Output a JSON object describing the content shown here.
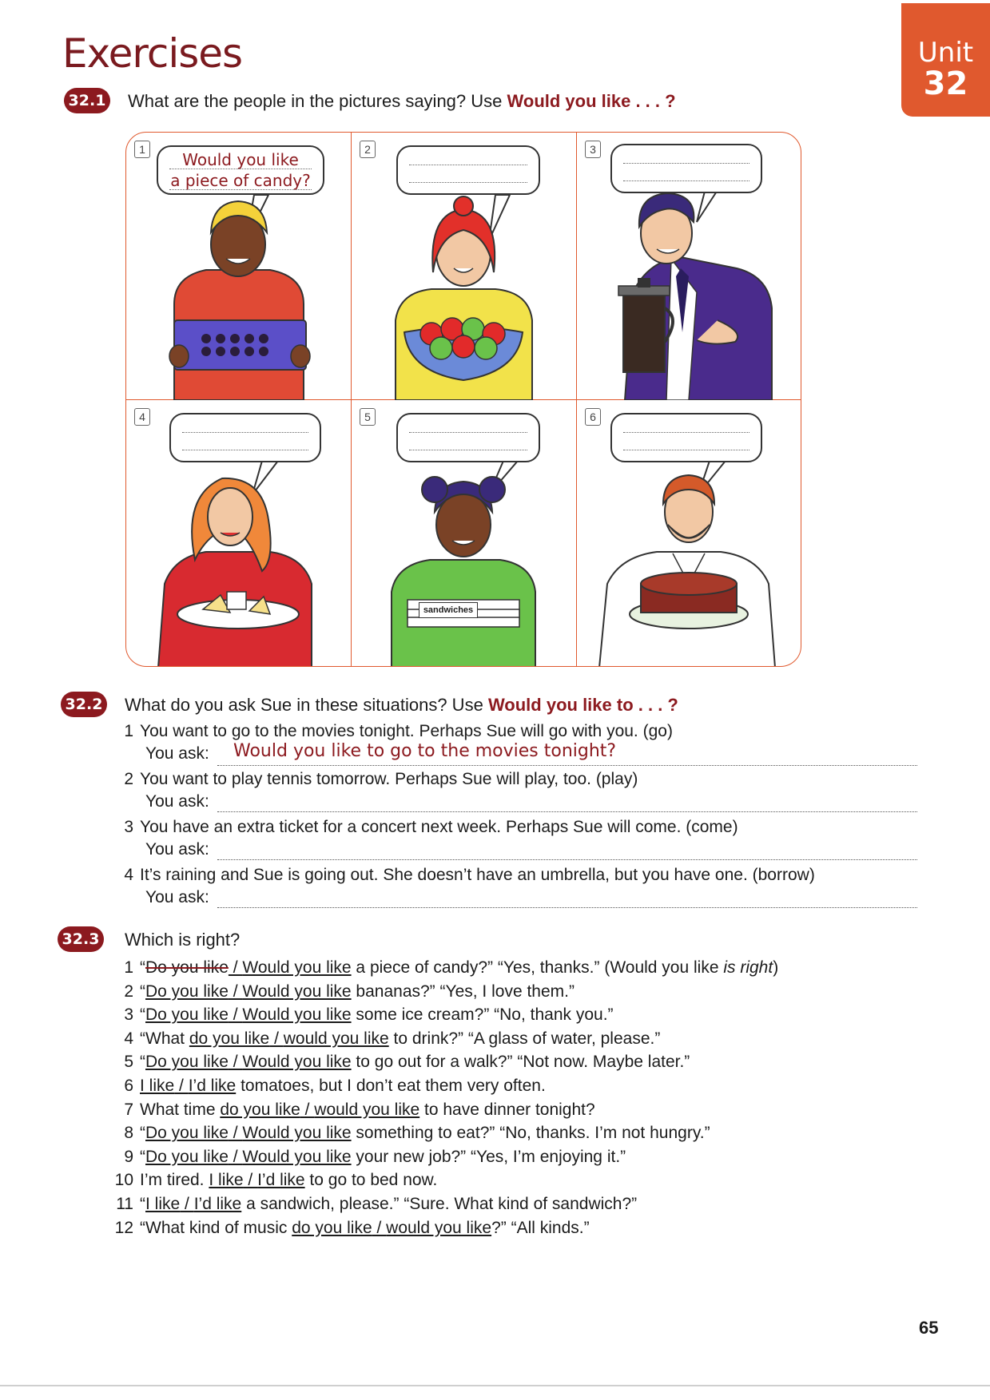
{
  "header": {
    "title": "Exercises",
    "unit_label": "Unit",
    "unit_number": "32"
  },
  "ex1": {
    "badge": "32.1",
    "prompt": "What are the people in the pictures saying? Use",
    "prompt_bold": "Would you like . . . ?",
    "cells": [
      {
        "num": "1",
        "answer_line1": "Would you like",
        "answer_line2": "a piece of candy?"
      },
      {
        "num": "2"
      },
      {
        "num": "3"
      },
      {
        "num": "4"
      },
      {
        "num": "5",
        "sign": "sandwiches"
      },
      {
        "num": "6"
      }
    ]
  },
  "ex2": {
    "badge": "32.2",
    "prompt": "What do you ask Sue in these situations? Use",
    "prompt_bold": "Would you like to . . . ?",
    "ask_label": "You ask:",
    "items": [
      {
        "n": "1",
        "text": "You want to go to the movies tonight.  Perhaps Sue will go with you.  (go)",
        "answer": "Would you like to go to the movies tonight?"
      },
      {
        "n": "2",
        "text": "You want to play tennis tomorrow.  Perhaps Sue will play, too.  (play)",
        "answer": ""
      },
      {
        "n": "3",
        "text": "You have an extra ticket for a concert next week.  Perhaps Sue will come.  (come)",
        "answer": ""
      },
      {
        "n": "4",
        "text": "It’s raining and Sue is going out.  She doesn’t have an umbrella, but you have one.  (borrow)",
        "answer": ""
      }
    ]
  },
  "ex3": {
    "badge": "32.3",
    "prompt": "Which is right?",
    "items": [
      {
        "n": "1",
        "pre": "“",
        "s1": "Do you like",
        "sep": " / ",
        "s2": "Would you like",
        "post": " a piece of candy?”   “Yes, thanks.”  (Would you like ",
        "note": "is right",
        "close": ")"
      },
      {
        "n": "2",
        "pre": "“",
        "s1": "Do you like",
        "sep": " / ",
        "s2": "Would you like",
        "post": " bananas?”   “Yes, I love them.”"
      },
      {
        "n": "3",
        "pre": "“",
        "s1": "Do you like",
        "sep": " / ",
        "s2": "Would you like",
        "post": " some ice cream?”   “No, thank you.”"
      },
      {
        "n": "4",
        "pre": "“What ",
        "s1": "do you like",
        "sep": " / ",
        "s2": "would you like",
        "post": " to drink?”   “A glass of water, please.”"
      },
      {
        "n": "5",
        "pre": "“",
        "s1": "Do you like",
        "sep": " / ",
        "s2": "Would you like",
        "post": " to go out for a walk?”   “Not now.  Maybe later.”"
      },
      {
        "n": "6",
        "pre": "",
        "s1": "I like",
        "sep": " / ",
        "s2": "I’d like",
        "post": " tomatoes, but I don’t eat them very often."
      },
      {
        "n": "7",
        "pre": "What time ",
        "s1": "do you like",
        "sep": " / ",
        "s2": "would you like",
        "post": " to have dinner tonight?"
      },
      {
        "n": "8",
        "pre": "“",
        "s1": "Do you like",
        "sep": " / ",
        "s2": "Would you like",
        "post": " something to eat?”   “No, thanks.  I’m not hungry.”"
      },
      {
        "n": "9",
        "pre": "“",
        "s1": "Do you like",
        "sep": " / ",
        "s2": "Would you like",
        "post": " your new job?”   “Yes, I’m enjoying it.”"
      },
      {
        "n": "10",
        "pre": "I’m tired. ",
        "s1": "I like",
        "sep": " / ",
        "s2": "I’d like",
        "post": " to go to bed now."
      },
      {
        "n": "11",
        "pre": "“",
        "s1": "I like",
        "sep": " / ",
        "s2": "I’d like",
        "post": " a sandwich, please.”   “Sure.  What kind of sandwich?”"
      },
      {
        "n": "12",
        "pre": "“What kind of music ",
        "s1": "do you like",
        "sep": " / ",
        "s2": "would you like",
        "post": "?”   “All kinds.”"
      }
    ]
  },
  "footer": {
    "page_number": "65"
  },
  "colors": {
    "maroon": "#8c1a1f",
    "orange": "#e0592e"
  }
}
